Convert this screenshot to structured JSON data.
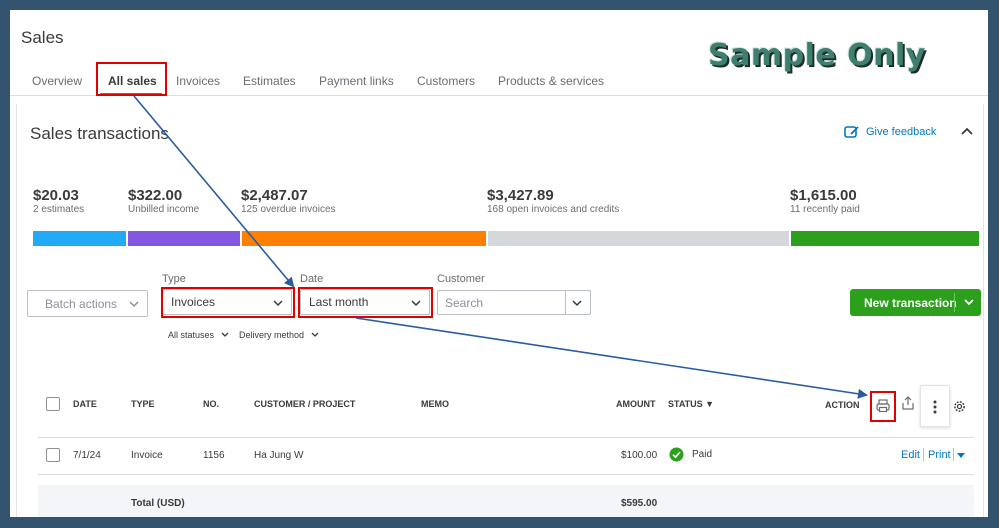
{
  "page": {
    "title": "Sales",
    "watermark": "Sample Only"
  },
  "tabs": [
    {
      "label": "Overview"
    },
    {
      "label": "All sales"
    },
    {
      "label": "Invoices"
    },
    {
      "label": "Estimates"
    },
    {
      "label": "Payment links"
    },
    {
      "label": "Customers"
    },
    {
      "label": "Products & services"
    }
  ],
  "section": {
    "title": "Sales transactions",
    "feedback_label": "Give feedback"
  },
  "stats": [
    {
      "amount": "$20.03",
      "label": "2 estimates",
      "color": "#21abf6"
    },
    {
      "amount": "$322.00",
      "label": "Unbilled income",
      "color": "#8457e0"
    },
    {
      "amount": "$2,487.07",
      "label": "125 overdue invoices",
      "color": "#ff8000"
    },
    {
      "amount": "$3,427.89",
      "label": "168 open invoices and credits",
      "color": "#d4d7dc"
    },
    {
      "amount": "$1,615.00",
      "label": "11 recently paid",
      "color": "#2ca01c"
    }
  ],
  "filters": {
    "batch_label": "Batch actions",
    "type_label": "Type",
    "type_value": "Invoices",
    "date_label": "Date",
    "date_value": "Last month",
    "customer_label": "Customer",
    "customer_placeholder": "Search",
    "status_filter": "All statuses",
    "delivery_filter": "Delivery method",
    "new_transaction": "New transaction"
  },
  "table": {
    "headers": [
      "DATE",
      "TYPE",
      "NO.",
      "CUSTOMER / PROJECT",
      "MEMO",
      "AMOUNT",
      "STATUS ▼",
      "ACTION"
    ],
    "rows": [
      {
        "date": "7/1/24",
        "type": "Invoice",
        "no": "1156",
        "customer": "Ha Jung W",
        "memo": "",
        "amount": "$100.00",
        "status": "Paid",
        "action_edit": "Edit",
        "action_print": "Print"
      }
    ],
    "total_label": "Total (USD)",
    "total_amount": "$595.00"
  },
  "colors": {
    "accent": "#2ca01c",
    "link": "#0077c5",
    "highlight": "#e00000",
    "arrow": "#2a5ca0"
  }
}
